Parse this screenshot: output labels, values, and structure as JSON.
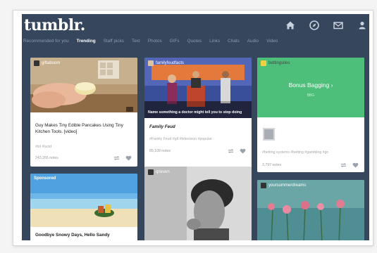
{
  "app": {
    "logo": "tumblr."
  },
  "nav": {
    "icons": [
      "home-icon",
      "compass-icon",
      "mail-icon",
      "person-icon"
    ],
    "tabs": [
      "Recommended for you",
      "Trending",
      "Staff picks",
      "Text",
      "Photos",
      "GIFs",
      "Quotes",
      "Links",
      "Chats",
      "Audio",
      "Video"
    ],
    "active_tab": "Trending"
  },
  "posts": [
    {
      "blog": "giftaboom",
      "title": "Guy Makes Tiny Edible Pancakes Using Tiny Kitchen Tools. [video]",
      "tags": "#lol  #lucid",
      "notes": "243,266 notes"
    },
    {
      "blog": "familyfeudfacts",
      "caption": "Name something a doctor might tell you to stop doing",
      "title": "Family Feud",
      "tags": "#Family Feud  #gif  #television  #popular",
      "notes": "85,109 notes"
    },
    {
      "blog": "bettingsites",
      "promo_title": "Bonus Bagging ›",
      "promo_sub": "BBG",
      "tags": "#betting systems  #betting  #gambling  #go",
      "notes": "3,797 notes"
    },
    {
      "label": "Sponsored",
      "title": "Goodbye Snowy Days, Hello Sandy"
    },
    {
      "blog": "qrieven"
    },
    {
      "blog": "yoursummerdreams"
    }
  ],
  "colors": {
    "dashboard_bg": "#36465d",
    "promo_green": "#4dbf7a",
    "nav_inactive": "#8a9bb0"
  }
}
